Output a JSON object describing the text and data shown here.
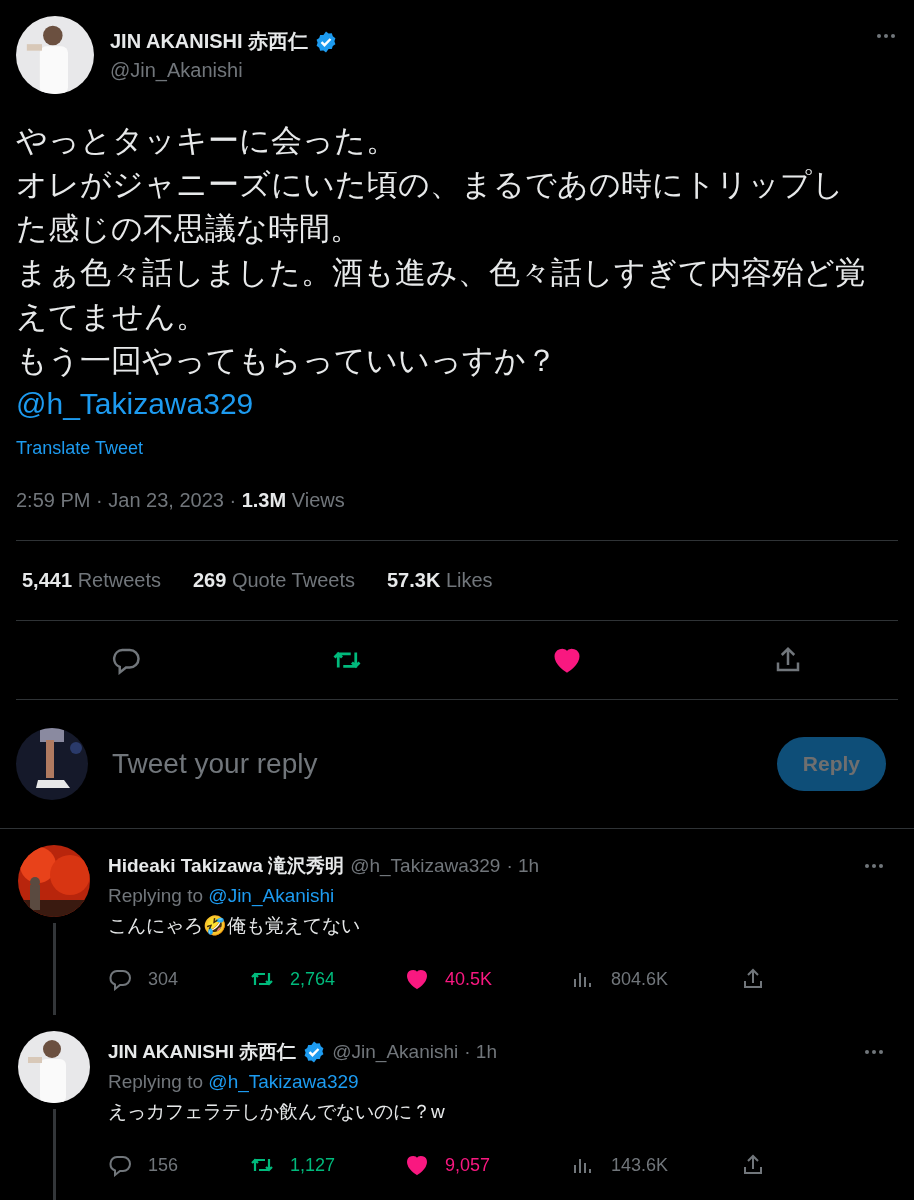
{
  "tweet": {
    "author": {
      "name": "JIN AKANISHI 赤西仁",
      "verified": true,
      "handle": "@Jin_Akanishi"
    },
    "lines": [
      "やっとタッキーに会った。",
      "オレがジャニーズにいた頃の、まるであの時にトリップした感じの不思議な時間。",
      "まぁ色々話しました。酒も進み、色々話しすぎて内容殆ど覚えてません。",
      "もう一回やってもらっていいっすか？"
    ],
    "mention": "@h_Takizawa329",
    "translate": "Translate Tweet",
    "time": "2:59 PM · Jan 23, 2023 · ",
    "views_count": "1.3M",
    "views_label": "Views",
    "stats": [
      {
        "count": "5,441",
        "label": "Retweets"
      },
      {
        "count": "269",
        "label": "Quote Tweets"
      },
      {
        "count": "57.3K",
        "label": "Likes"
      }
    ],
    "retweeted": true,
    "liked": true
  },
  "reply_box": {
    "placeholder": "Tweet your reply",
    "button": "Reply",
    "disabled": true
  },
  "replies": [
    {
      "name": "Hideaki Takizawa 滝沢秀明",
      "verified": false,
      "handle": "@h_Takizawa329",
      "time": "· 1h",
      "replying_label": "Replying to",
      "replying_to": "@Jin_Akanishi",
      "text": "こんにゃろ🤣俺も覚えてない",
      "replies": "304",
      "retweets": "2,764",
      "likes": "40.5K",
      "views": "804.6K",
      "retweeted": true,
      "liked": true
    },
    {
      "name": "JIN AKANISHI 赤西仁",
      "verified": true,
      "handle": "@Jin_Akanishi",
      "time": "· 1h",
      "replying_label": "Replying to",
      "replying_to": "@h_Takizawa329",
      "text": "えっカフェラテしか飲んでないのに？w",
      "replies": "156",
      "retweets": "1,127",
      "likes": "9,057",
      "views": "143.6K",
      "retweeted": true,
      "liked": true
    }
  ]
}
